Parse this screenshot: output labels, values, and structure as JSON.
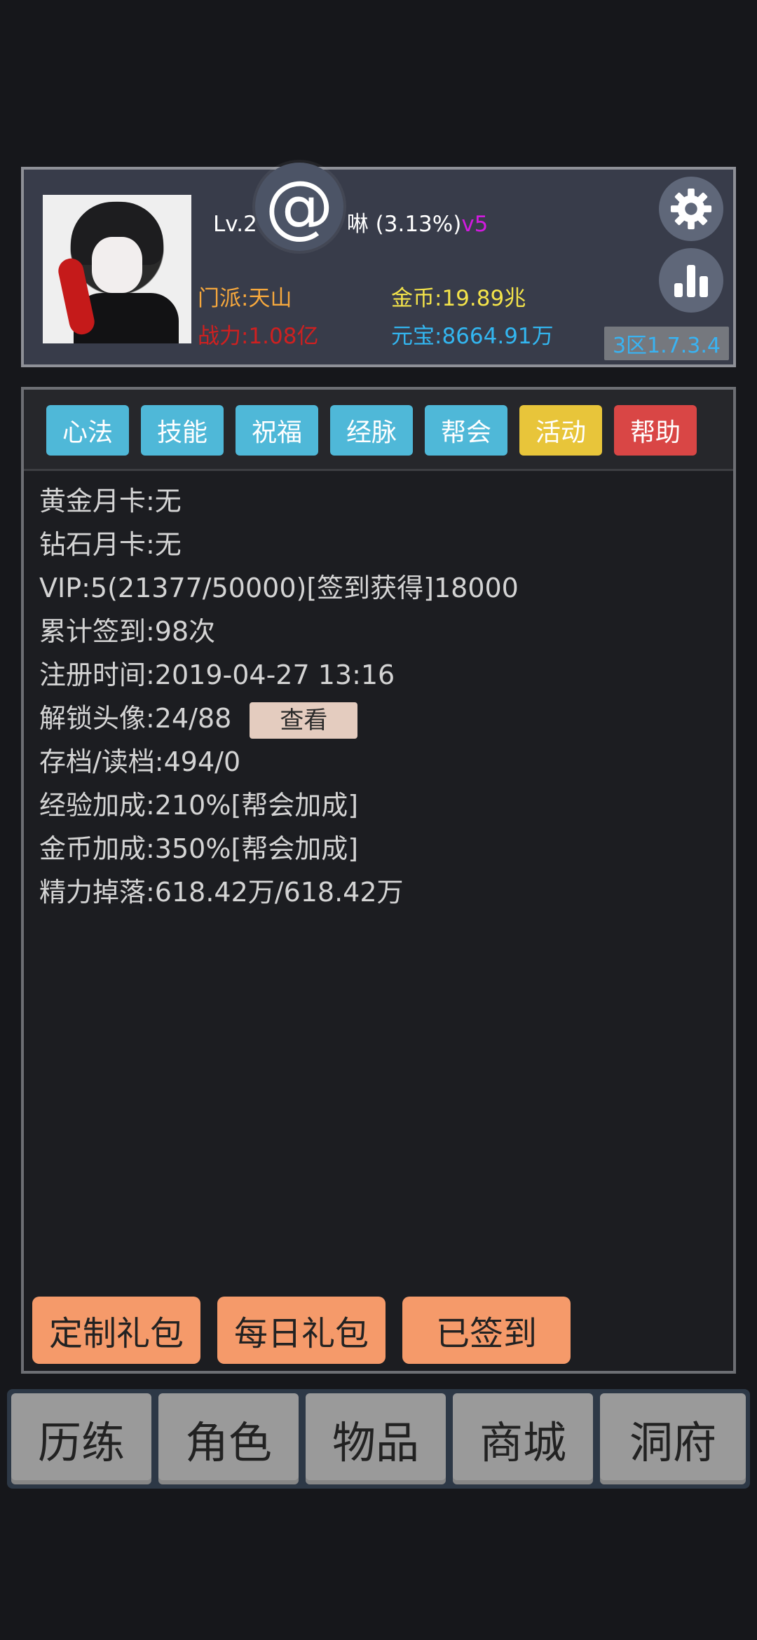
{
  "header": {
    "level_text": "Lv.2",
    "name_suffix": "啉 (3.13%)",
    "vip_tag": "v5",
    "at_symbol": "@",
    "sect": "门派:天山",
    "power": "战力:1.08亿",
    "gold": "金币:19.89兆",
    "ingot": "元宝:8664.91万",
    "server": "3区1.7.3.4",
    "icons": {
      "settings": "gear-icon",
      "stats": "bar-chart-icon"
    }
  },
  "tabs": [
    {
      "label": "心法",
      "color": "#4fb8d8"
    },
    {
      "label": "技能",
      "color": "#4fb8d8"
    },
    {
      "label": "祝福",
      "color": "#4fb8d8"
    },
    {
      "label": "经脉",
      "color": "#4fb8d8"
    },
    {
      "label": "帮会",
      "color": "#4fb8d8"
    },
    {
      "label": "活动",
      "color": "#e8c53a"
    },
    {
      "label": "帮助",
      "color": "#d94645"
    }
  ],
  "info": {
    "gold_card": "黄金月卡:无",
    "diamond_card": "钻石月卡:无",
    "vip": "VIP:5(21377/50000)[签到获得]18000",
    "checkin_total": "累计签到:98次",
    "register_time": "注册时间:2019-04-27 13:16",
    "avatars_unlocked": "解锁头像:24/88",
    "view_button": "查看",
    "save_load": "存档/读档:494/0",
    "exp_bonus": "经验加成:210%[帮会加成]",
    "gold_bonus": "金币加成:350%[帮会加成]",
    "energy_drop": "精力掉落:618.42万/618.42万"
  },
  "gifts": {
    "custom": "定制礼包",
    "daily": "每日礼包",
    "signed": "已签到"
  },
  "nav": [
    "历练",
    "角色",
    "物品",
    "商城",
    "洞府"
  ]
}
